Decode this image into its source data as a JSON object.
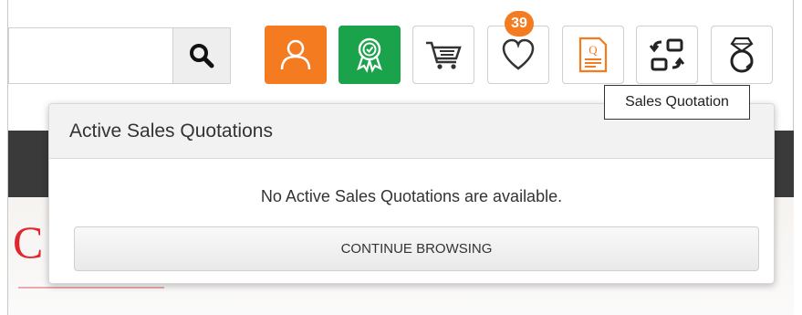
{
  "search": {
    "placeholder": "",
    "value": ""
  },
  "header_icons": [
    {
      "name": "account-icon",
      "color": "#f47b20"
    },
    {
      "name": "rewards-icon",
      "color": "#1aa34a"
    },
    {
      "name": "cart-icon"
    },
    {
      "name": "wishlist-icon",
      "badge": "39"
    },
    {
      "name": "sales-quotation-icon",
      "color": "#f47b20"
    },
    {
      "name": "compare-icon"
    },
    {
      "name": "ring-icon"
    }
  ],
  "wishlist_badge": "39",
  "tooltip": {
    "text": "Sales Quotation"
  },
  "popover": {
    "title": "Active Sales Quotations",
    "message": "No Active Sales Quotations are available.",
    "button_label": "CONTINUE BROWSING"
  },
  "hero": {
    "partial_letter": "C"
  },
  "colors": {
    "accent_orange": "#f47b20",
    "accent_green": "#1aa34a",
    "brand_red": "#e0262f"
  }
}
